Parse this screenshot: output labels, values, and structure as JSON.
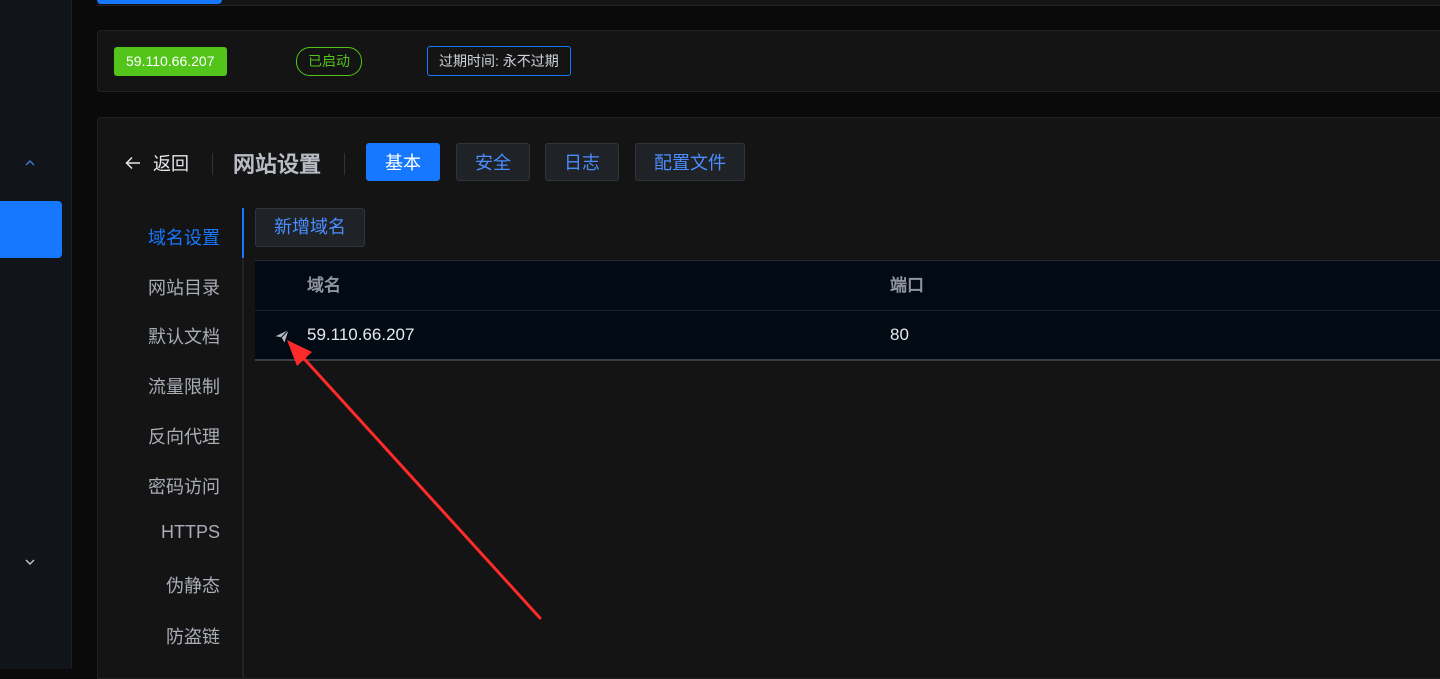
{
  "status": {
    "ip": "59.110.66.207",
    "run_state": "已启动",
    "expire": "过期时间: 永不过期"
  },
  "header": {
    "back_label": "返回",
    "title": "网站设置",
    "tabs": [
      {
        "label": "基本"
      },
      {
        "label": "安全"
      },
      {
        "label": "日志"
      },
      {
        "label": "配置文件"
      }
    ]
  },
  "side_menu": {
    "items": [
      {
        "label": "域名设置"
      },
      {
        "label": "网站目录"
      },
      {
        "label": "默认文档"
      },
      {
        "label": "流量限制"
      },
      {
        "label": "反向代理"
      },
      {
        "label": "密码访问"
      },
      {
        "label": "HTTPS"
      },
      {
        "label": "伪静态"
      },
      {
        "label": "防盗链"
      }
    ]
  },
  "domains": {
    "add_label": "新增域名",
    "columns": {
      "domain": "域名",
      "port": "端口"
    },
    "rows": [
      {
        "domain": "59.110.66.207",
        "port": "80"
      }
    ]
  },
  "icons": {
    "back": "arrow-left-icon",
    "send": "send-icon",
    "sidebar_up": "chevron-up-icon",
    "sidebar_down": "chevron-down-icon"
  },
  "colors": {
    "accent": "#1677ff",
    "success": "#52c41a",
    "annotation_arrow": "#ff2a2a"
  }
}
